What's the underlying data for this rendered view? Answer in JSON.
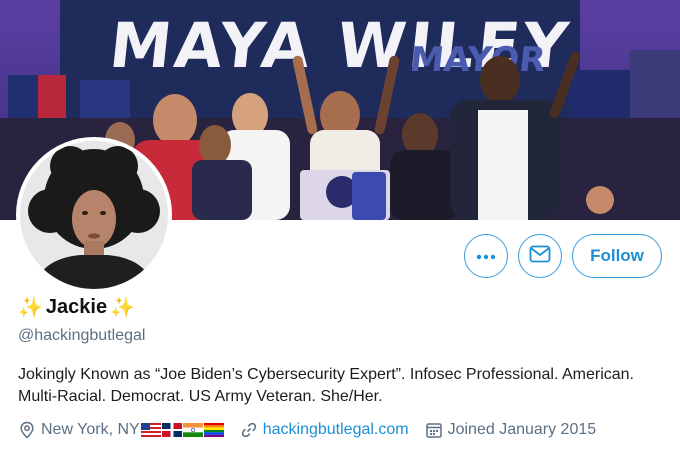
{
  "banner": {
    "headline": "MAYA WILEY",
    "subline": "MAYOR"
  },
  "profile": {
    "display_name": "Jackie",
    "decoration_icon": "sparkles-icon",
    "handle": "@hackingbutlegal",
    "bio": "Jokingly Known as “Joe Biden’s Cybersecurity Expert”. Infosec Professional. American. Multi-Racial. Democrat. US Army Veteran. She/Her.",
    "location": "New York, NY",
    "location_flags": [
      "us-flag",
      "dominican-republic-flag",
      "india-flag",
      "rainbow-flag"
    ],
    "website": "hackingbutlegal.com",
    "joined": "Joined January 2015"
  },
  "actions": {
    "more_icon": "more-dots-icon",
    "message_icon": "mail-icon",
    "follow_label": "Follow"
  },
  "colors": {
    "accent": "#1d8fd6",
    "muted_text": "#5b7083",
    "sparkle": "#f4b400"
  }
}
